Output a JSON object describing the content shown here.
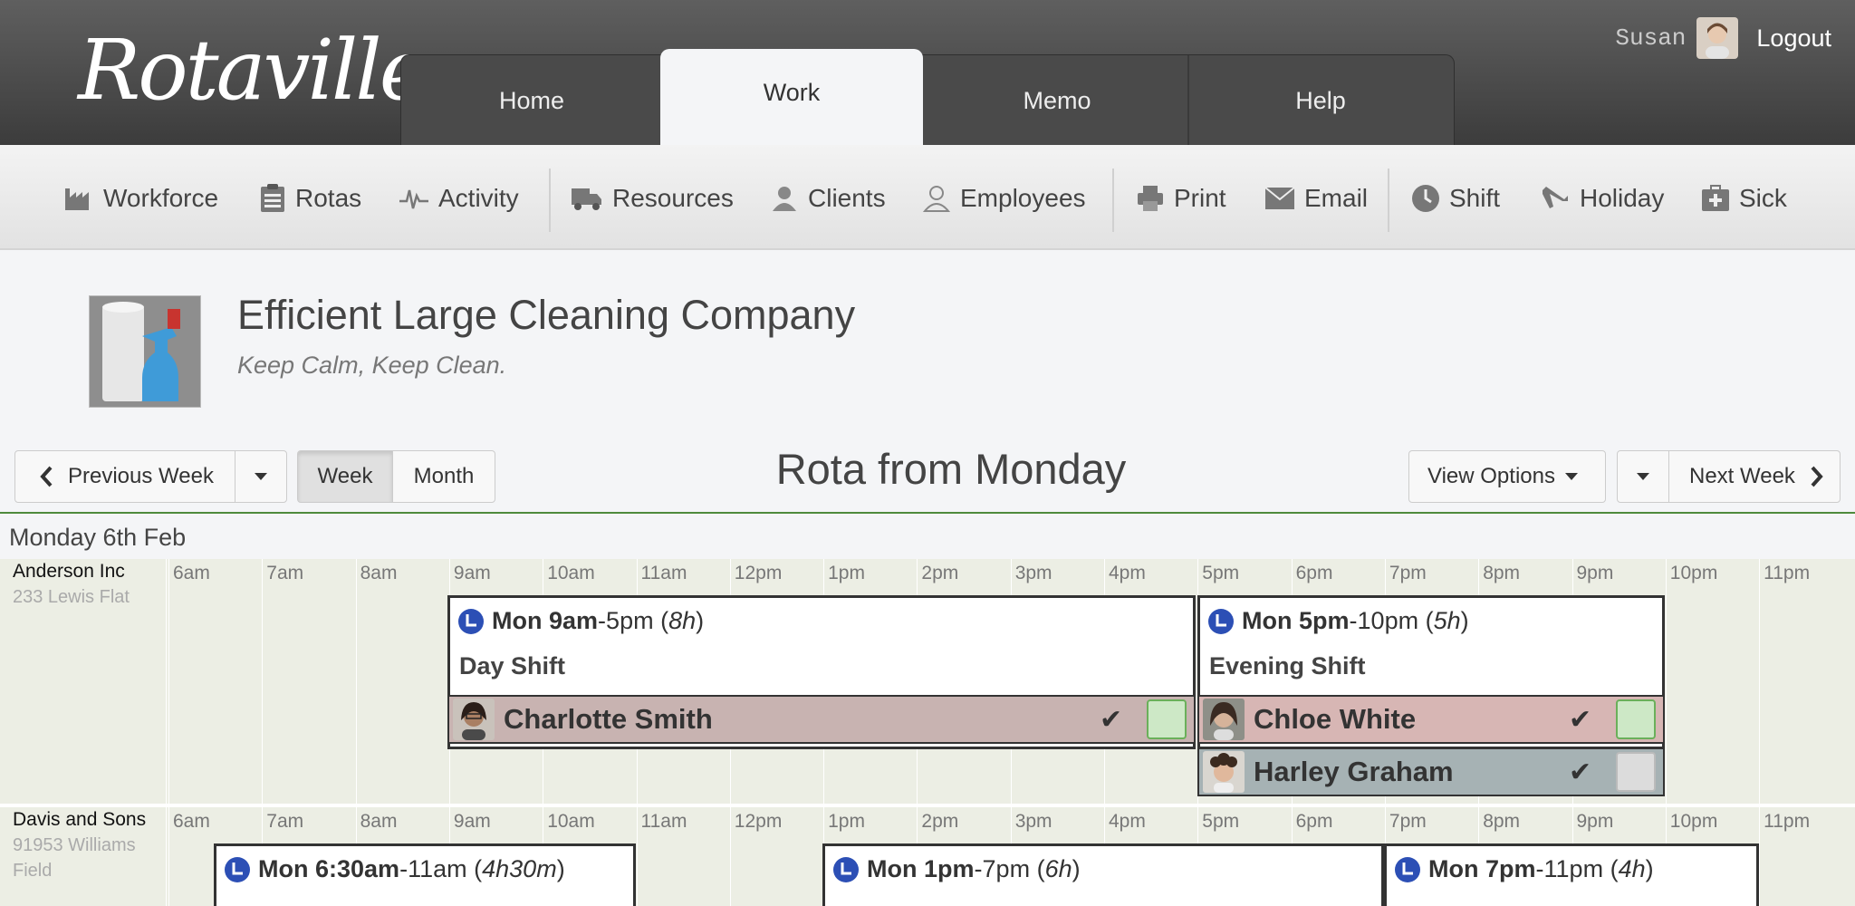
{
  "app": {
    "name": "Rotaville"
  },
  "user": {
    "name": "Susan",
    "logout_label": "Logout"
  },
  "nav": {
    "tabs": [
      {
        "label": "Home"
      },
      {
        "label": "Work"
      },
      {
        "label": "Memo"
      },
      {
        "label": "Help"
      }
    ],
    "active": "Work"
  },
  "toolbar": {
    "items": [
      {
        "label": "Workforce",
        "icon": "factory-icon"
      },
      {
        "label": "Rotas",
        "icon": "clipboard-icon"
      },
      {
        "label": "Activity",
        "icon": "pulse-icon"
      },
      {
        "label": "Resources",
        "icon": "truck-icon"
      },
      {
        "label": "Clients",
        "icon": "client-user-icon"
      },
      {
        "label": "Employees",
        "icon": "user-outline-icon"
      },
      {
        "label": "Print",
        "icon": "printer-icon"
      },
      {
        "label": "Email",
        "icon": "envelope-icon"
      },
      {
        "label": "Shift",
        "icon": "clock-icon"
      },
      {
        "label": "Holiday",
        "icon": "plane-icon"
      },
      {
        "label": "Sick",
        "icon": "medical-kit-icon"
      }
    ]
  },
  "company": {
    "name": "Efficient Large Cleaning Company",
    "tagline": "Keep Calm, Keep Clean."
  },
  "controls": {
    "previous_week": "Previous Week",
    "week": "Week",
    "month": "Month",
    "rota_title": "Rota from Monday",
    "view_options": "View Options",
    "next_week": "Next Week",
    "active_view": "Week"
  },
  "day": {
    "heading": "Monday 6th Feb"
  },
  "hours": [
    "6am",
    "7am",
    "8am",
    "9am",
    "10am",
    "11am",
    "12pm",
    "1pm",
    "2pm",
    "3pm",
    "4pm",
    "5pm",
    "6pm",
    "7pm",
    "8pm",
    "9pm",
    "10pm",
    "11pm"
  ],
  "clients": [
    {
      "name": "Anderson Inc",
      "address": "233 Lewis Flat",
      "shifts": [
        {
          "day": "Mon",
          "start": "9am",
          "end": "5pm",
          "duration": "8h",
          "name": "Day Shift",
          "employees": [
            {
              "name": "Charlotte Smith",
              "confirmed": true,
              "status_color": "#cde8c6",
              "row_color": "#c8b3b1"
            }
          ]
        },
        {
          "day": "Mon",
          "start": "5pm",
          "end": "10pm",
          "duration": "5h",
          "name": "Evening Shift",
          "employees": [
            {
              "name": "Chloe White",
              "confirmed": true,
              "status_color": "#cde8c6",
              "row_color": "#d7b6b4"
            },
            {
              "name": "Harley Graham",
              "confirmed": true,
              "status_color": "#dcdcdc",
              "row_color": "#a6b2b4"
            }
          ]
        }
      ]
    },
    {
      "name": "Davis and Sons",
      "address": "91953 Williams Field",
      "shifts": [
        {
          "day": "Mon",
          "start": "6:30am",
          "end": "11am",
          "duration": "4h30m"
        },
        {
          "day": "Mon",
          "start": "1pm",
          "end": "7pm",
          "duration": "6h"
        },
        {
          "day": "Mon",
          "start": "7pm",
          "end": "11pm",
          "duration": "4h"
        }
      ]
    }
  ],
  "colors": {
    "header_dark": "#4a4a4a",
    "accent_green": "#4f8a3c",
    "shift_icon_blue": "#2c4fb5",
    "grid_bg": "#eceee4"
  }
}
